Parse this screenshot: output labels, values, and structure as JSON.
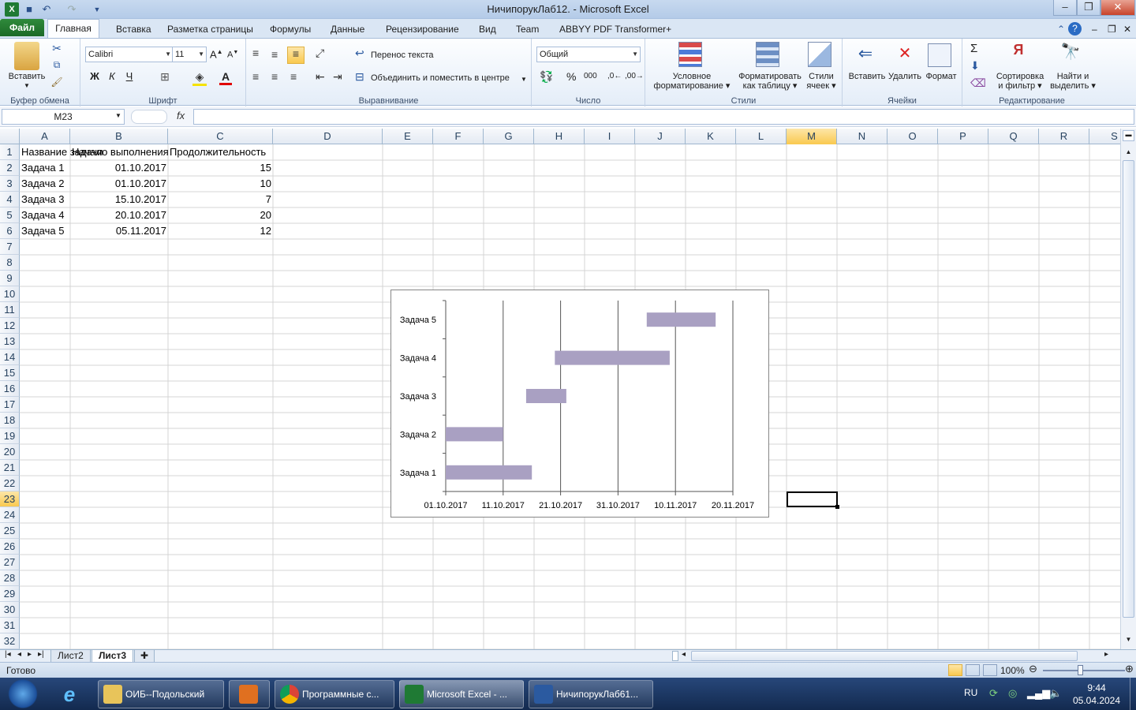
{
  "window": {
    "title": "НичипорукЛаб12. - Microsoft Excel"
  },
  "tabs": {
    "file": "Файл",
    "items": [
      "Главная",
      "Вставка",
      "Разметка страницы",
      "Формулы",
      "Данные",
      "Рецензирование",
      "Вид",
      "Team",
      "ABBYY PDF Transformer+"
    ]
  },
  "ribbon": {
    "clipboard": {
      "label": "Буфер обмена",
      "paste": "Вставить"
    },
    "font": {
      "label": "Шрифт",
      "name": "Calibri",
      "size": "11",
      "bold": "Ж",
      "italic": "К",
      "underline": "Ч"
    },
    "alignment": {
      "label": "Выравнивание",
      "wrap": "Перенос текста",
      "merge": "Объединить и поместить в центре"
    },
    "number": {
      "label": "Число",
      "format": "Общий"
    },
    "styles": {
      "label": "Стили",
      "conditional_1": "Условное",
      "conditional_2": "форматирование",
      "table_1": "Форматировать",
      "table_2": "как таблицу",
      "cell_1": "Стили",
      "cell_2": "ячеек"
    },
    "cells": {
      "label": "Ячейки",
      "insert": "Вставить",
      "delete": "Удалить",
      "format": "Формат"
    },
    "editing": {
      "label": "Редактирование",
      "sort_1": "Сортировка",
      "sort_2": "и фильтр",
      "find_1": "Найти и",
      "find_2": "выделить"
    }
  },
  "formula_bar": {
    "name_box": "M23",
    "fx": "fx",
    "value": ""
  },
  "columns": [
    "A",
    "B",
    "C",
    "D",
    "E",
    "F",
    "G",
    "H",
    "I",
    "J",
    "K",
    "L",
    "M",
    "N",
    "O",
    "P",
    "Q",
    "R",
    "S"
  ],
  "selected_column": "M",
  "selected_row": 23,
  "rows": [
    "1",
    "2",
    "3",
    "4",
    "5",
    "6",
    "7",
    "8",
    "9",
    "10",
    "11",
    "12",
    "13",
    "14",
    "15",
    "16",
    "17",
    "18",
    "19",
    "20",
    "21",
    "22",
    "23",
    "24",
    "25",
    "26",
    "27",
    "28",
    "29",
    "30",
    "31",
    "32"
  ],
  "table": {
    "headers": [
      "Название задачи",
      "Начало выполнения",
      "Продолжительность"
    ],
    "rows": [
      [
        "Задача 1",
        "01.10.2017",
        "15"
      ],
      [
        "Задача 2",
        "01.10.2017",
        "10"
      ],
      [
        "Задача 3",
        "15.10.2017",
        "7"
      ],
      [
        "Задача 4",
        "20.10.2017",
        "20"
      ],
      [
        "Задача 5",
        "05.11.2017",
        "12"
      ]
    ]
  },
  "chart_data": {
    "type": "bar",
    "orientation": "horizontal",
    "categories": [
      "Задача 1",
      "Задача 2",
      "Задача 3",
      "Задача 4",
      "Задача 5"
    ],
    "start": [
      "01.10.2017",
      "01.10.2017",
      "15.10.2017",
      "20.10.2017",
      "05.11.2017"
    ],
    "duration_days": [
      15,
      10,
      7,
      20,
      12
    ],
    "x_ticks": [
      "01.10.2017",
      "11.10.2017",
      "21.10.2017",
      "31.10.2017",
      "10.11.2017",
      "20.11.2017"
    ],
    "xlim": [
      "01.10.2017",
      "20.11.2017"
    ],
    "grid": "vertical",
    "legend": "none",
    "bar_color": "#a9a0c2"
  },
  "sheets": [
    "Лист2",
    "Лист3"
  ],
  "active_sheet": "Лист3",
  "status": {
    "ready": "Готово",
    "zoom": "100%"
  },
  "taskbar": {
    "items": [
      "ОИБ--Подольский",
      "Программные с...",
      "Microsoft Excel - ...",
      "НичипорукЛаб61..."
    ],
    "lang": "RU",
    "time": "9:44",
    "date": "05.04.2024"
  }
}
